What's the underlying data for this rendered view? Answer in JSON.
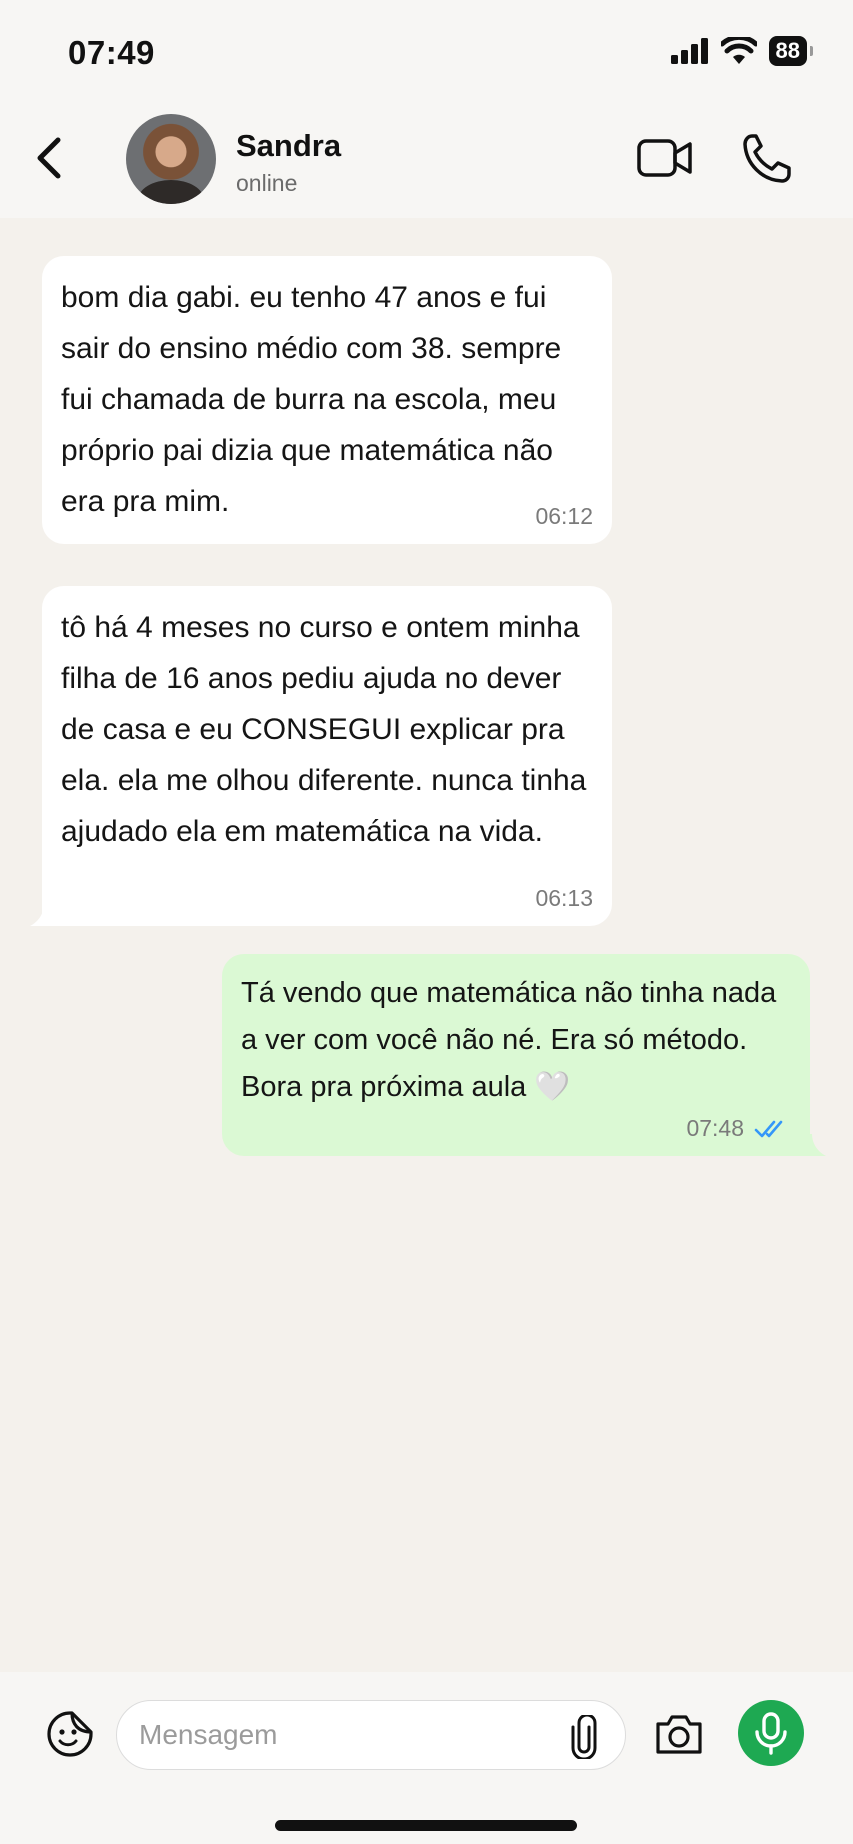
{
  "status_bar": {
    "time": "07:49",
    "battery": "88"
  },
  "header": {
    "contact_name": "Sandra",
    "contact_status": "online"
  },
  "messages": [
    {
      "direction": "incoming",
      "text": "bom dia gabi. eu tenho 47 anos e fui sair do ensino médio com 38. sempre fui chamada de burra na escola, meu próprio pai dizia que matemática não era pra mim.",
      "time": "06:12"
    },
    {
      "direction": "incoming",
      "text": "tô há 4 meses no curso e ontem minha filha de 16 anos pediu ajuda no dever de casa e eu CONSEGUI explicar pra ela. ela me olhou diferente. nunca tinha ajudado ela em matemática na vida.",
      "time": "06:13"
    },
    {
      "direction": "outgoing",
      "text": "Tá vendo que matemática não tinha nada a ver com você não né. Era só método. Bora pra próxima aula 🤍",
      "time": "07:48",
      "status": "read"
    }
  ],
  "input_bar": {
    "placeholder": "Mensagem"
  },
  "colors": {
    "chat_background": "#f4f1ec",
    "incoming_bubble": "#ffffff",
    "outgoing_bubble": "#dbf9d4",
    "mic_button": "#1ea952",
    "read_ticks": "#3497f9"
  },
  "icons": [
    "signal-icon",
    "wifi-icon",
    "battery-icon",
    "back-arrow-icon",
    "video-call-icon",
    "phone-icon",
    "sticker-icon",
    "attach-icon",
    "camera-icon",
    "mic-icon",
    "double-check-icon"
  ]
}
